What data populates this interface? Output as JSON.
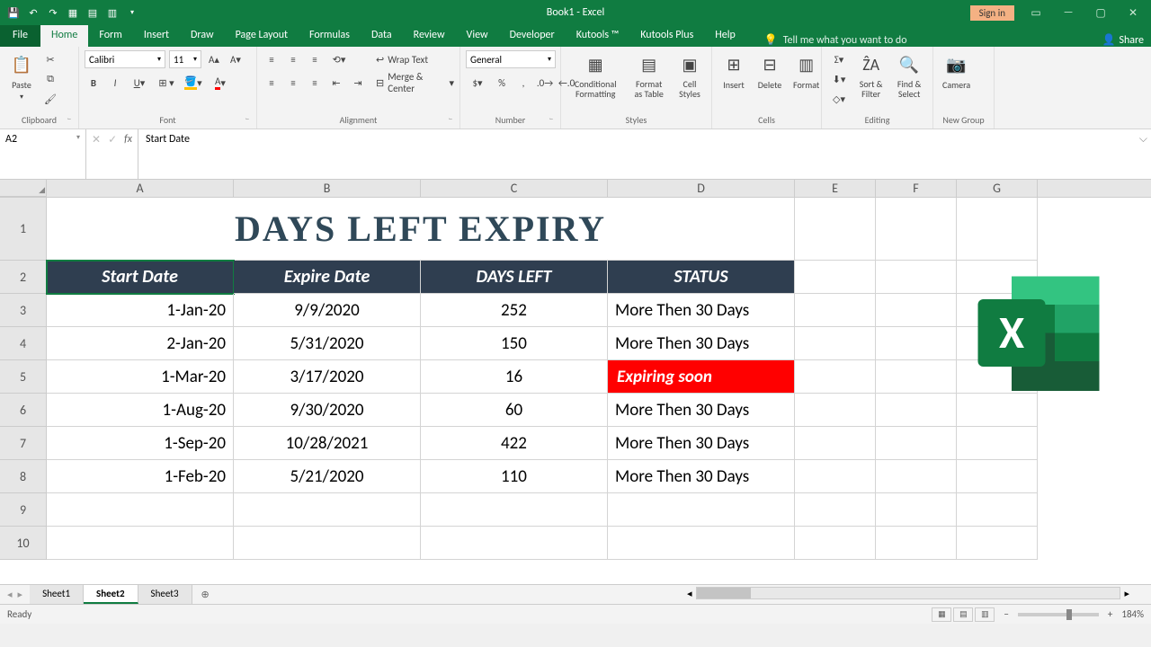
{
  "titlebar": {
    "title": "Book1 - Excel",
    "signin": "Sign in"
  },
  "tabs": {
    "file": "File",
    "items": [
      "Home",
      "Form",
      "Insert",
      "Draw",
      "Page Layout",
      "Formulas",
      "Data",
      "Review",
      "View",
      "Developer",
      "Kutools ™",
      "Kutools Plus",
      "Help"
    ],
    "active": "Home",
    "tellme": "Tell me what you want to do",
    "share": "Share"
  },
  "ribbon": {
    "clipboard": {
      "label": "Clipboard",
      "paste": "Paste"
    },
    "font": {
      "label": "Font",
      "name": "Calibri",
      "size": "11"
    },
    "alignment": {
      "label": "Alignment",
      "wrap": "Wrap Text",
      "merge": "Merge & Center"
    },
    "number": {
      "label": "Number",
      "format": "General"
    },
    "styles": {
      "label": "Styles",
      "cond": "Conditional Formatting",
      "table": "Format as Table",
      "cell": "Cell Styles"
    },
    "cells": {
      "label": "Cells",
      "insert": "Insert",
      "delete": "Delete",
      "format": "Format"
    },
    "editing": {
      "label": "Editing",
      "sort": "Sort & Filter",
      "find": "Find & Select"
    },
    "newgroup": {
      "label": "New Group",
      "camera": "Camera"
    }
  },
  "namebox": "A2",
  "formula": "Start Date",
  "columns": [
    "A",
    "B",
    "C",
    "D",
    "E",
    "F",
    "G"
  ],
  "rows": [
    "1",
    "2",
    "3",
    "4",
    "5",
    "6",
    "7",
    "8",
    "9",
    "10"
  ],
  "sheet": {
    "title": "DAYS LEFT EXPIRY",
    "headers": [
      "Start Date",
      "Expire Date",
      "DAYS LEFT",
      "STATUS"
    ],
    "data": [
      {
        "start": "1-Jan-20",
        "expire": "9/9/2020",
        "days": "252",
        "status": "More Then 30 Days",
        "flag": false
      },
      {
        "start": "2-Jan-20",
        "expire": "5/31/2020",
        "days": "150",
        "status": "More Then 30 Days",
        "flag": false
      },
      {
        "start": "1-Mar-20",
        "expire": "3/17/2020",
        "days": "16",
        "status": "Expiring soon",
        "flag": true
      },
      {
        "start": "1-Aug-20",
        "expire": "9/30/2020",
        "days": "60",
        "status": "More Then 30 Days",
        "flag": false
      },
      {
        "start": "1-Sep-20",
        "expire": "10/28/2021",
        "days": "422",
        "status": "More Then 30 Days",
        "flag": false
      },
      {
        "start": "1-Feb-20",
        "expire": "5/21/2020",
        "days": "110",
        "status": "More Then 30 Days",
        "flag": false
      }
    ]
  },
  "sheets": [
    "Sheet1",
    "Sheet2",
    "Sheet3"
  ],
  "active_sheet": "Sheet2",
  "status": {
    "ready": "Ready",
    "zoom": "184%"
  }
}
